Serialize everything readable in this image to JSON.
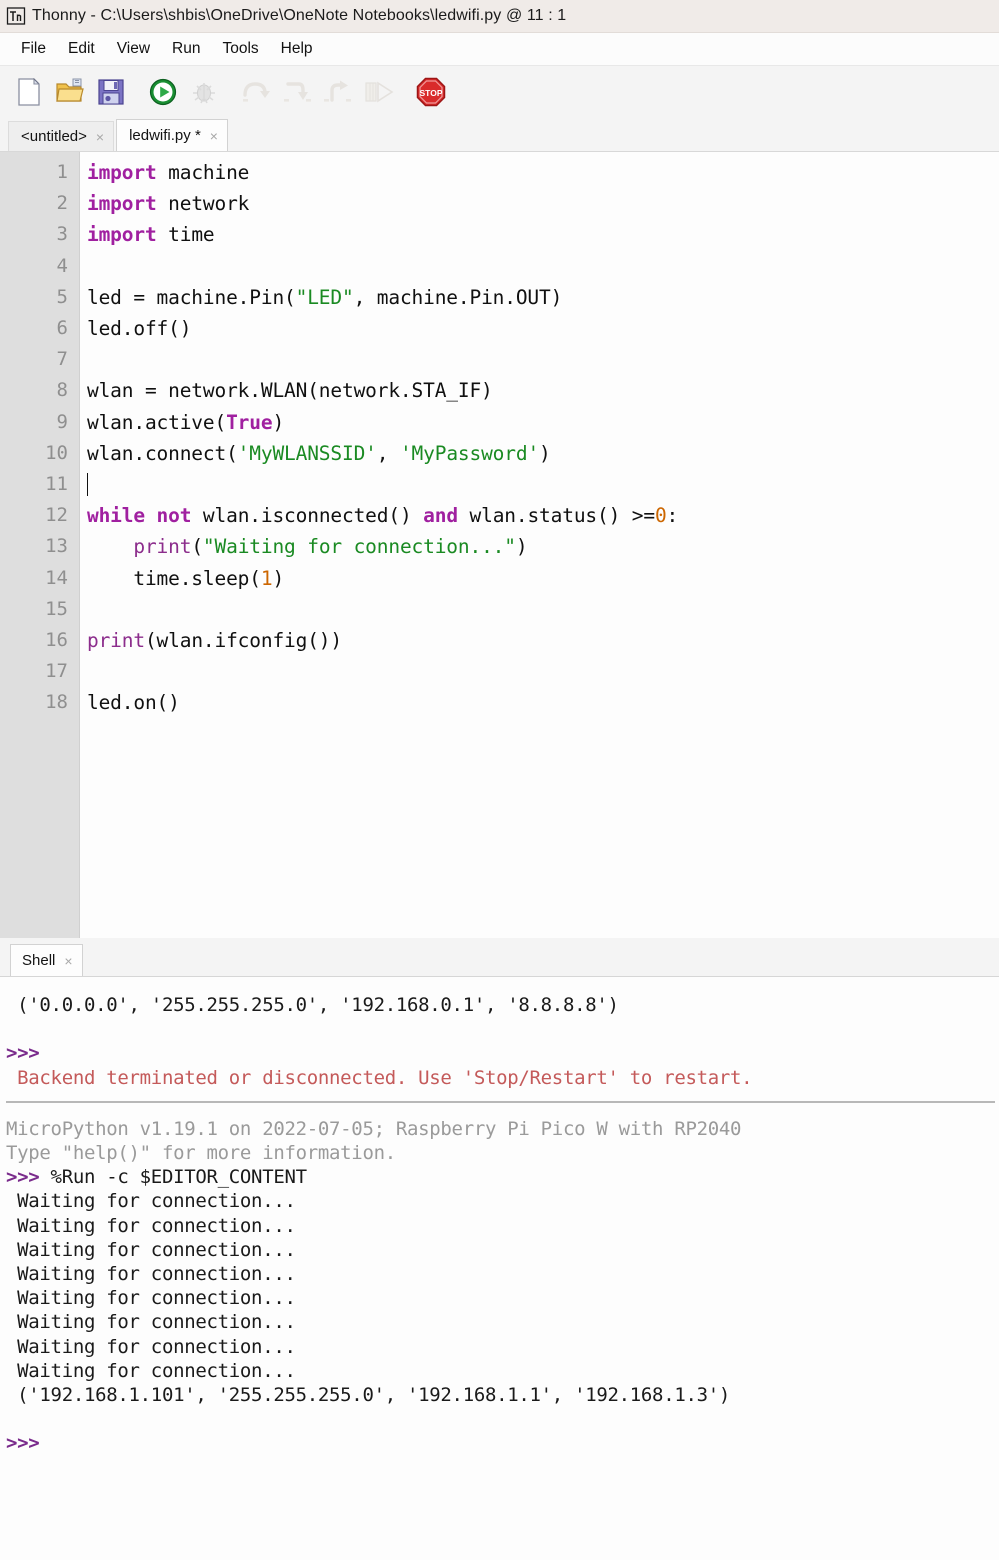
{
  "window": {
    "app_name": "Thonny",
    "separator": "-",
    "file_path": "C:\\Users\\shbis\\OneDrive\\OneNote Notebooks\\ledwifi.py",
    "position_marker": "@",
    "cursor_position": "11 : 1",
    "logo_text": "Th"
  },
  "menu": {
    "items": [
      {
        "label": "File"
      },
      {
        "label": "Edit"
      },
      {
        "label": "View"
      },
      {
        "label": "Run"
      },
      {
        "label": "Tools"
      },
      {
        "label": "Help"
      }
    ]
  },
  "toolbar": {
    "buttons": [
      {
        "name": "new-file-icon",
        "title": "New",
        "enabled": true
      },
      {
        "name": "open-file-icon",
        "title": "Load",
        "enabled": true
      },
      {
        "name": "save-file-icon",
        "title": "Save",
        "enabled": true
      },
      {
        "name": "run-icon",
        "title": "Run current script",
        "enabled": true
      },
      {
        "name": "debug-icon",
        "title": "Debug current script",
        "enabled": false
      },
      {
        "name": "step-over-icon",
        "title": "Step over",
        "enabled": false
      },
      {
        "name": "step-into-icon",
        "title": "Step into",
        "enabled": false
      },
      {
        "name": "step-out-icon",
        "title": "Step out",
        "enabled": false
      },
      {
        "name": "resume-icon",
        "title": "Resume",
        "enabled": false
      },
      {
        "name": "stop-icon",
        "title": "Stop/Restart backend",
        "enabled": true
      }
    ]
  },
  "editor": {
    "tabs": [
      {
        "label": "<untitled>",
        "active": false,
        "close": "×"
      },
      {
        "label": "ledwifi.py *",
        "active": true,
        "close": "×"
      }
    ],
    "line_numbers": [
      1,
      2,
      3,
      4,
      5,
      6,
      7,
      8,
      9,
      10,
      11,
      12,
      13,
      14,
      15,
      16,
      17,
      18
    ],
    "cursor_line": 11,
    "lines": [
      {
        "n": 1,
        "tokens": [
          {
            "t": "kw",
            "v": "import"
          },
          {
            "t": "p",
            "v": " machine"
          }
        ]
      },
      {
        "n": 2,
        "tokens": [
          {
            "t": "kw",
            "v": "import"
          },
          {
            "t": "p",
            "v": " network"
          }
        ]
      },
      {
        "n": 3,
        "tokens": [
          {
            "t": "kw",
            "v": "import"
          },
          {
            "t": "p",
            "v": " time"
          }
        ]
      },
      {
        "n": 4,
        "tokens": []
      },
      {
        "n": 5,
        "tokens": [
          {
            "t": "p",
            "v": "led = machine.Pin("
          },
          {
            "t": "str",
            "v": "\"LED\""
          },
          {
            "t": "p",
            "v": ", machine.Pin.OUT)"
          }
        ]
      },
      {
        "n": 6,
        "tokens": [
          {
            "t": "p",
            "v": "led.off()"
          }
        ]
      },
      {
        "n": 7,
        "tokens": []
      },
      {
        "n": 8,
        "tokens": [
          {
            "t": "p",
            "v": "wlan = network.WLAN(network.STA_IF)"
          }
        ]
      },
      {
        "n": 9,
        "tokens": [
          {
            "t": "p",
            "v": "wlan.active("
          },
          {
            "t": "kw",
            "v": "True"
          },
          {
            "t": "p",
            "v": ")"
          }
        ]
      },
      {
        "n": 10,
        "tokens": [
          {
            "t": "p",
            "v": "wlan.connect("
          },
          {
            "t": "str",
            "v": "'MyWLANSSID'"
          },
          {
            "t": "p",
            "v": ", "
          },
          {
            "t": "str",
            "v": "'MyPassword'"
          },
          {
            "t": "p",
            "v": ")"
          }
        ]
      },
      {
        "n": 11,
        "tokens": [],
        "caret": true
      },
      {
        "n": 12,
        "tokens": [
          {
            "t": "kw",
            "v": "while"
          },
          {
            "t": "p",
            "v": " "
          },
          {
            "t": "kw",
            "v": "not"
          },
          {
            "t": "p",
            "v": " wlan.isconnected() "
          },
          {
            "t": "kw",
            "v": "and"
          },
          {
            "t": "p",
            "v": " wlan.status() >="
          },
          {
            "t": "num",
            "v": "0"
          },
          {
            "t": "p",
            "v": ":"
          }
        ]
      },
      {
        "n": 13,
        "tokens": [
          {
            "t": "p",
            "v": "    "
          },
          {
            "t": "bin",
            "v": "print"
          },
          {
            "t": "p",
            "v": "("
          },
          {
            "t": "str",
            "v": "\"Waiting for connection...\""
          },
          {
            "t": "p",
            "v": ")"
          }
        ]
      },
      {
        "n": 14,
        "tokens": [
          {
            "t": "p",
            "v": "    time.sleep("
          },
          {
            "t": "num",
            "v": "1"
          },
          {
            "t": "p",
            "v": ")"
          }
        ]
      },
      {
        "n": 15,
        "tokens": []
      },
      {
        "n": 16,
        "tokens": [
          {
            "t": "bin",
            "v": "print"
          },
          {
            "t": "p",
            "v": "(wlan.ifconfig())"
          }
        ]
      },
      {
        "n": 17,
        "tokens": []
      },
      {
        "n": 18,
        "tokens": [
          {
            "t": "p",
            "v": "led.on()"
          }
        ]
      }
    ]
  },
  "shell": {
    "tab_label": "Shell",
    "tab_close": "×",
    "lines": [
      {
        "type": "clipped",
        "text": ""
      },
      {
        "type": "output",
        "text": " ('0.0.0.0', '255.255.255.0', '192.168.0.1', '8.8.8.8')"
      },
      {
        "type": "blank",
        "text": ""
      },
      {
        "type": "prompt",
        "text": ">>>"
      },
      {
        "type": "error",
        "text": " Backend terminated or disconnected. Use 'Stop/Restart' to restart."
      },
      {
        "type": "separator",
        "text": ""
      },
      {
        "type": "banner",
        "text": "MicroPython v1.19.1 on 2022-07-05; Raspberry Pi Pico W with RP2040"
      },
      {
        "type": "banner",
        "text": "Type \"help()\" for more information."
      },
      {
        "type": "command",
        "prompt": ">>>",
        "text": " %Run -c $EDITOR_CONTENT"
      },
      {
        "type": "output",
        "text": " Waiting for connection..."
      },
      {
        "type": "output",
        "text": " Waiting for connection..."
      },
      {
        "type": "output",
        "text": " Waiting for connection..."
      },
      {
        "type": "output",
        "text": " Waiting for connection..."
      },
      {
        "type": "output",
        "text": " Waiting for connection..."
      },
      {
        "type": "output",
        "text": " Waiting for connection..."
      },
      {
        "type": "output",
        "text": " Waiting for connection..."
      },
      {
        "type": "output",
        "text": " Waiting for connection..."
      },
      {
        "type": "output",
        "text": " ('192.168.1.101', '255.255.255.0', '192.168.1.1', '192.168.1.3')"
      },
      {
        "type": "blank",
        "text": ""
      },
      {
        "type": "prompt",
        "text": ">>>"
      }
    ]
  },
  "colors": {
    "keyword": "#a020a0",
    "builtin": "#8c2d8c",
    "string": "#1a8a22",
    "number": "#cc6600",
    "prompt": "#7a2b8c",
    "error": "#c45a5a",
    "banner": "#9a9a9a",
    "gutter_bg": "#dedede",
    "titlebar_bg": "#f0ebe8"
  }
}
